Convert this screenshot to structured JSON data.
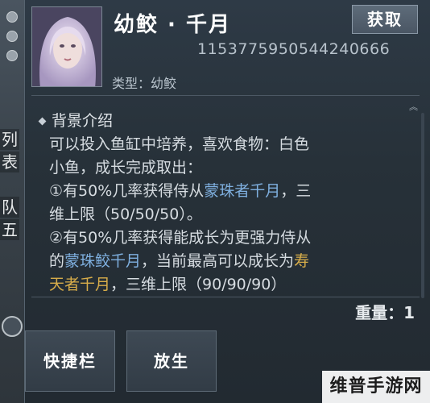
{
  "side_chars": [
    "列",
    "表",
    "队",
    "五"
  ],
  "item": {
    "title": "幼鲛 · 千月",
    "get_label": "获取",
    "id": "1153775950544240666",
    "type_line": "类型：幼鲛"
  },
  "description": {
    "heading": "背景介绍",
    "line1": "可以投入鱼缸中培养，喜欢食物：白色",
    "line2": "小鱼，成长完成取出：",
    "line3_a": "①有50%几率获得侍从",
    "line3_b": "蒙珠者千月",
    "line3_c": "，三",
    "line4": "维上限（50/50/50）。",
    "line5": "②有50%几率获得能成长为更强力侍从",
    "line6_a": "的",
    "line6_b": "蒙珠鲛千月",
    "line6_c": "，当前最高可以成长为",
    "line6_d": "寿",
    "line7_a": "天者千月",
    "line7_b": "，三维上限（90/90/90）"
  },
  "weight": "重量：1",
  "buttons": {
    "shortcut": "快捷栏",
    "release": "放生"
  },
  "watermark": "维普手游网",
  "colors": {
    "highlight_blue": "#7fb0e0",
    "highlight_gold": "#d7ad4a"
  }
}
